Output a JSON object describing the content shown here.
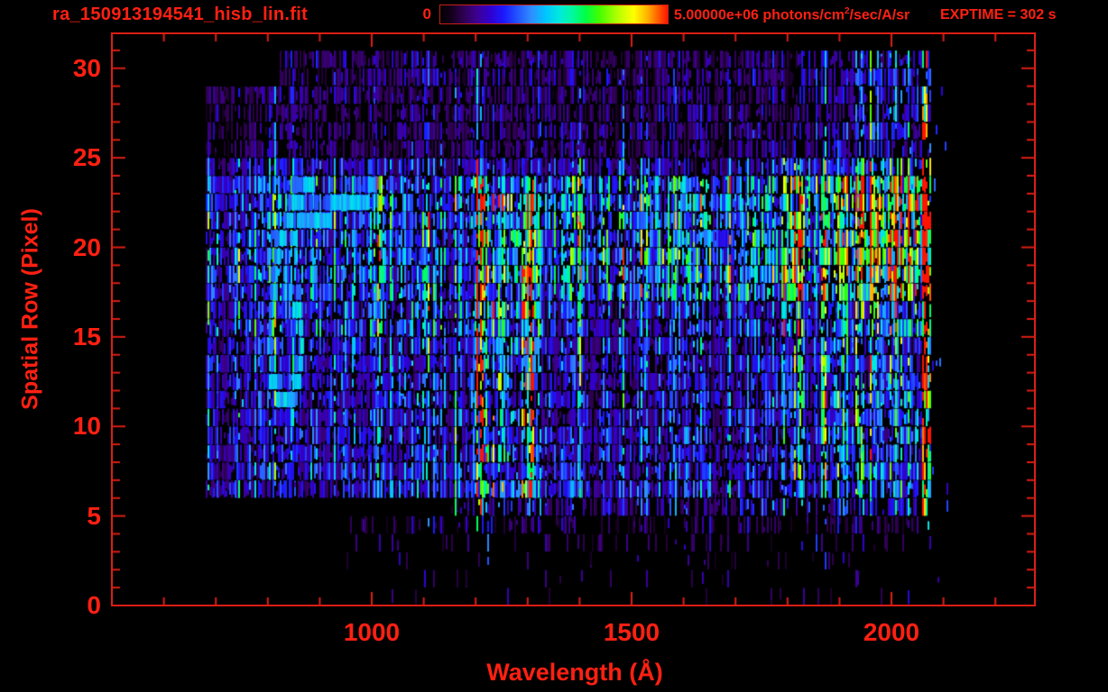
{
  "header": {
    "title": "ra_150913194541_hisb_lin.fit",
    "exptime": "EXPTIME = 302 s",
    "colorbar": {
      "min_label": "0",
      "max_label_prefix": "5.00000e+06 photons/cm",
      "max_label_sup": "2",
      "max_label_suffix": "/sec/A/sr"
    }
  },
  "colors": {
    "text_red": "#ff2012",
    "frame_red": "#dc1e14",
    "background": "#000000"
  },
  "chart_data": {
    "type": "heatmap",
    "title": "ra_150913194541_hisb_lin.fit",
    "xlabel": "Wavelength (Å)",
    "ylabel": "Spatial Row (Pixel)",
    "xlim": [
      498,
      2278
    ],
    "ylim": [
      0,
      32
    ],
    "x_major_ticks": [
      1000,
      1500,
      2000
    ],
    "x_minor_tick_step": 100,
    "y_major_ticks": [
      0,
      5,
      10,
      15,
      20,
      25,
      30
    ],
    "y_minor_tick_step": 1,
    "colorbar_scale": {
      "min": 0,
      "max": 5000000,
      "units": "photons/cm^2/sec/A/sr"
    },
    "exposure_time_s": 302,
    "data_extent": {
      "wavelength_A": [
        680,
        2076
      ],
      "rows": [
        1,
        30
      ]
    },
    "render": {
      "seed": 7,
      "row_density": [
        0.03,
        0.05,
        0.06,
        0.16,
        0.35,
        0.55,
        0.93,
        0.93,
        0.9,
        0.93,
        0.9,
        0.93,
        0.9,
        0.93,
        0.93,
        0.95,
        0.93,
        0.95,
        0.95,
        0.95,
        0.95,
        0.95,
        0.95,
        0.93,
        0.85,
        0.72,
        0.74,
        0.7,
        0.75,
        0.75,
        0.7,
        0
      ],
      "row_level": [
        0.12,
        0.12,
        0.12,
        0.13,
        0.13,
        0.2,
        0.25,
        0.26,
        0.24,
        0.25,
        0.24,
        0.26,
        0.25,
        0.26,
        0.26,
        0.27,
        0.26,
        0.27,
        0.28,
        0.28,
        0.28,
        0.28,
        0.28,
        0.27,
        0.22,
        0.15,
        0.15,
        0.14,
        0.15,
        0.15,
        0.14,
        0
      ],
      "row_lambda_default": [
        680,
        2076
      ],
      "row_lambda_overrides": {
        "0": [
          950,
          2076
        ],
        "1": [
          950,
          2076
        ],
        "2": [
          950,
          2076
        ],
        "3": [
          950,
          2076
        ],
        "4": [
          950,
          2076
        ],
        "5": [
          1150,
          2076
        ],
        "29": [
          820,
          2076
        ],
        "30": [
          820,
          2076
        ]
      },
      "colormap": [
        [
          0.0,
          "#000000"
        ],
        [
          0.05,
          "#14001e"
        ],
        [
          0.1,
          "#2e0050"
        ],
        [
          0.16,
          "#3d0090"
        ],
        [
          0.22,
          "#3000d0"
        ],
        [
          0.28,
          "#1a1aff"
        ],
        [
          0.34,
          "#2255ff"
        ],
        [
          0.4,
          "#2f8dff"
        ],
        [
          0.46,
          "#00c3ff"
        ],
        [
          0.52,
          "#00e8e0"
        ],
        [
          0.58,
          "#00f9a0"
        ],
        [
          0.64,
          "#00ff44"
        ],
        [
          0.7,
          "#44ff00"
        ],
        [
          0.78,
          "#b4ff00"
        ],
        [
          0.85,
          "#ffff00"
        ],
        [
          0.91,
          "#ffb400"
        ],
        [
          0.96,
          "#ff5a00"
        ],
        [
          1.0,
          "#ff1400"
        ]
      ],
      "features": [
        {
          "name": "lyman-alpha-core",
          "l": [
            1196,
            1222
          ],
          "r": [
            5,
            24.3
          ],
          "b": 2.6
        },
        {
          "name": "lyman-alpha-upper-faint",
          "l": [
            1196,
            1222
          ],
          "r": [
            24.3,
            30.8
          ],
          "b": 1.5
        },
        {
          "name": "lyman-alpha-lower-specks",
          "l": [
            1186,
            1232
          ],
          "r": [
            1,
            5
          ],
          "b": 2.0
        },
        {
          "name": "emission-line-1300",
          "l": [
            1286,
            1316
          ],
          "r": [
            5,
            24.3
          ],
          "b": 1.85
        },
        {
          "name": "interline-region",
          "l": [
            1222,
            1286
          ],
          "r": [
            5,
            24.3
          ],
          "b": 1.15
        },
        {
          "name": "vertical-line-1015",
          "l": [
            1009,
            1023
          ],
          "r": [
            3.5,
            24.3
          ],
          "b": 1.8
        },
        {
          "name": "vertical-line-1015-top",
          "l": [
            1009,
            1023
          ],
          "r": [
            17,
            24.3
          ],
          "b": 1.35
        },
        {
          "name": "band-1800",
          "l": [
            1789,
            1827
          ],
          "r": [
            5,
            24.5
          ],
          "b": 1.6
        },
        {
          "name": "band-1800-upper",
          "l": [
            1789,
            1827
          ],
          "r": [
            15,
            24.5
          ],
          "b": 1.3
        },
        {
          "name": "wash-left-top",
          "l": [
            680,
            1350
          ],
          "r": [
            15,
            24.3
          ],
          "b": 1.18
        },
        {
          "name": "wash-right-top",
          "l": [
            1350,
            2068
          ],
          "r": [
            17,
            24.3
          ],
          "b": 1.5
        },
        {
          "name": "wash-far-right",
          "l": [
            1865,
            2068
          ],
          "r": [
            5,
            30.8
          ],
          "b": 1.5
        },
        {
          "name": "wash-far-right-upper",
          "l": [
            1940,
            2068
          ],
          "r": [
            15,
            30.8
          ],
          "b": 1.25
        },
        {
          "name": "right-edge-hot-column",
          "l": [
            2056,
            2076
          ],
          "r": [
            1,
            30.8
          ],
          "b": 2.8,
          "spike": 0.3,
          "spike_mult": 1.6
        }
      ],
      "rungs": {
        "l": [
          1216,
          1316
        ],
        "rows": [
          6,
          8,
          10,
          12,
          14,
          16,
          18,
          20,
          22
        ],
        "b": 1.5
      },
      "hotspots": {
        "l": [
          1199,
          1221
        ],
        "spans": [
          [
            5.2,
            6.4,
            1.7
          ],
          [
            7.6,
            8.7,
            1.5
          ],
          [
            9.6,
            11.3,
            1.8
          ],
          [
            12.6,
            13.8,
            1.55
          ],
          [
            16.7,
            17.8,
            1.45
          ],
          [
            19.7,
            20.8,
            1.35
          ],
          [
            21.8,
            22.6,
            1.25
          ]
        ]
      },
      "strokes": [
        {
          "name": "loop-artifact",
          "pts": [
            [
              888,
              23.6
            ],
            [
              862,
              22.8
            ],
            [
              842,
              21.6
            ],
            [
              820,
              19.6
            ],
            [
              808,
              17.0
            ],
            [
              804,
              14.4
            ],
            [
              810,
              12.4
            ],
            [
              826,
              11.4
            ],
            [
              846,
              11.5
            ],
            [
              860,
              12.6
            ],
            [
              867,
              14.4
            ],
            [
              862,
              16.0
            ],
            [
              850,
              16.6
            ]
          ],
          "v": [
            0.4,
            0.56
          ]
        },
        {
          "name": "diagonal-streak",
          "pts": [
            [
              845,
              20.8
            ],
            [
              885,
              21.5
            ],
            [
              930,
              22.1
            ],
            [
              975,
              22.7
            ],
            [
              1005,
              23.2
            ]
          ],
          "v": [
            0.38,
            0.52
          ]
        }
      ],
      "overflow_specks": {
        "l": [
          2078,
          2108
        ],
        "r": [
          1,
          30
        ],
        "density": 0.05,
        "v": [
          0.16,
          0.38
        ]
      }
    }
  }
}
